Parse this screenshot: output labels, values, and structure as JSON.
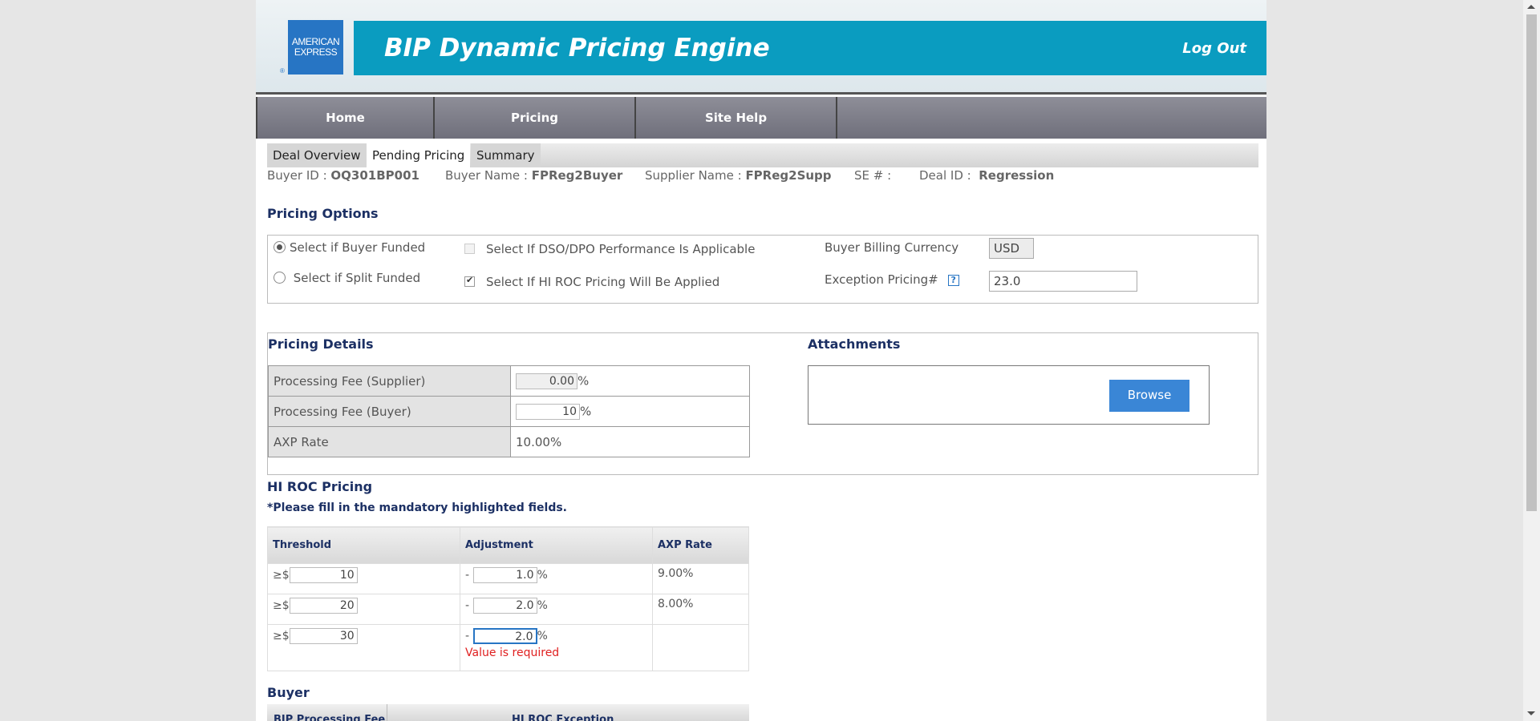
{
  "header": {
    "logo_line1": "AMERICAN",
    "logo_line2": "EXPRESS",
    "logo_reg": "®",
    "title": "BIP Dynamic Pricing Engine",
    "logout": "Log Out"
  },
  "nav": {
    "items": [
      "Home",
      "Pricing",
      "Site Help"
    ]
  },
  "tabs": [
    "Deal Overview",
    "Pending Pricing",
    "Summary"
  ],
  "active_tab": "Pending Pricing",
  "deal_info": {
    "buyer_id_label": "Buyer ID :",
    "buyer_id": "OQ301BP001",
    "buyer_name_label": "Buyer Name :",
    "buyer_name": "FPReg2Buyer",
    "supplier_name_label": "Supplier Name :",
    "supplier_name": "FPReg2Supp",
    "se_label": "SE # :",
    "deal_id_label": "Deal ID :",
    "deal_id": "Regression"
  },
  "pricing_options": {
    "title": "Pricing Options",
    "buyer_funded": "Select if Buyer Funded",
    "split_funded": "Select if Split Funded",
    "dso_dpo": "Select If DSO/DPO Performance Is Applicable",
    "hi_roc": "Select If HI ROC Pricing Will Be Applied",
    "billing_currency_label": "Buyer Billing Currency",
    "billing_currency": "USD",
    "exception_label": "Exception Pricing#",
    "exception_value": "23.0",
    "help_glyph": "?"
  },
  "pricing_details": {
    "title": "Pricing Details",
    "rows": [
      {
        "label": "Processing Fee (Supplier)",
        "value": "0.00",
        "suffix": "%"
      },
      {
        "label": "Processing Fee (Buyer)",
        "value": "10",
        "suffix": "%"
      },
      {
        "label": "AXP Rate",
        "value": "10.00%"
      }
    ]
  },
  "attachments": {
    "title": "Attachments",
    "browse": "Browse"
  },
  "hi_roc": {
    "title": "HI ROC Pricing",
    "note": "*Please fill in the mandatory highlighted fields.",
    "headers": [
      "Threshold",
      "Adjustment",
      "AXP Rate"
    ],
    "prefix": "≥$",
    "dash": "-",
    "pct": "%",
    "rows": [
      {
        "threshold": "10",
        "adjustment": "1.0",
        "axp_rate": "9.00%"
      },
      {
        "threshold": "20",
        "adjustment": "2.0",
        "axp_rate": "8.00%"
      },
      {
        "threshold": "30",
        "adjustment": "2.0",
        "axp_rate": "",
        "error": "Value is required"
      }
    ]
  },
  "buyer_section": {
    "title": "Buyer",
    "col1": "BIP Processing Fee",
    "col2": "HI ROC Exception"
  }
}
